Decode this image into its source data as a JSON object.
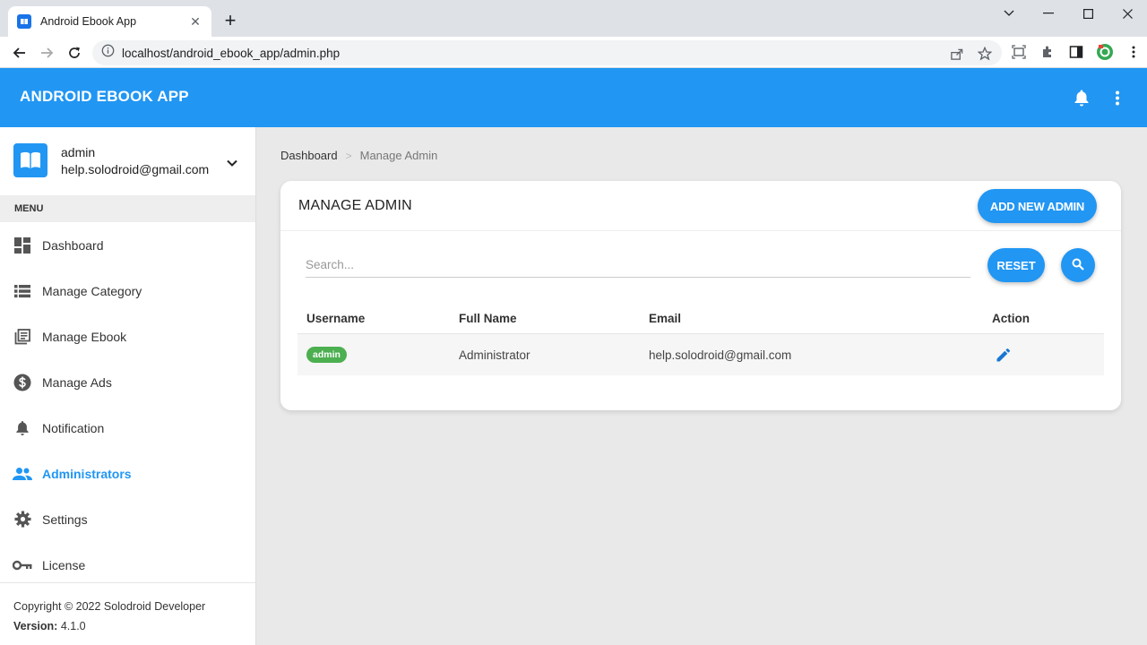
{
  "browser": {
    "tab_title": "Android Ebook App",
    "tab_close": "✕",
    "new_tab": "+",
    "url": "localhost/android_ebook_app/admin.php"
  },
  "header": {
    "title": "ANDROID EBOOK APP"
  },
  "user": {
    "name": "admin",
    "email": "help.solodroid@gmail.com"
  },
  "sidebar": {
    "menu_header": "MENU",
    "items": [
      {
        "label": "Dashboard",
        "icon": "dashboard-icon"
      },
      {
        "label": "Manage Category",
        "icon": "list-icon"
      },
      {
        "label": "Manage Ebook",
        "icon": "library-icon"
      },
      {
        "label": "Manage Ads",
        "icon": "dollar-icon"
      },
      {
        "label": "Notification",
        "icon": "bell-icon"
      },
      {
        "label": "Administrators",
        "icon": "people-icon",
        "active": true
      },
      {
        "label": "Settings",
        "icon": "gear-icon"
      },
      {
        "label": "License",
        "icon": "key-icon"
      }
    ],
    "footer": {
      "copyright": "Copyright © 2022 Solodroid Developer",
      "version_label": "Version:",
      "version_value": "4.1.0"
    }
  },
  "breadcrumb": {
    "items": [
      "Dashboard",
      "Manage Admin"
    ],
    "separator": ">"
  },
  "card": {
    "title": "MANAGE ADMIN",
    "add_button": "ADD NEW ADMIN"
  },
  "search": {
    "placeholder": "Search...",
    "value": "",
    "reset_label": "RESET"
  },
  "table": {
    "headers": [
      "Username",
      "Full Name",
      "Email",
      "Action"
    ],
    "rows": [
      {
        "username": "admin",
        "full_name": "Administrator",
        "email": "help.solodroid@gmail.com"
      }
    ]
  },
  "colors": {
    "primary": "#2196f3",
    "badge": "#4caf50",
    "edit_icon": "#1976d2"
  }
}
